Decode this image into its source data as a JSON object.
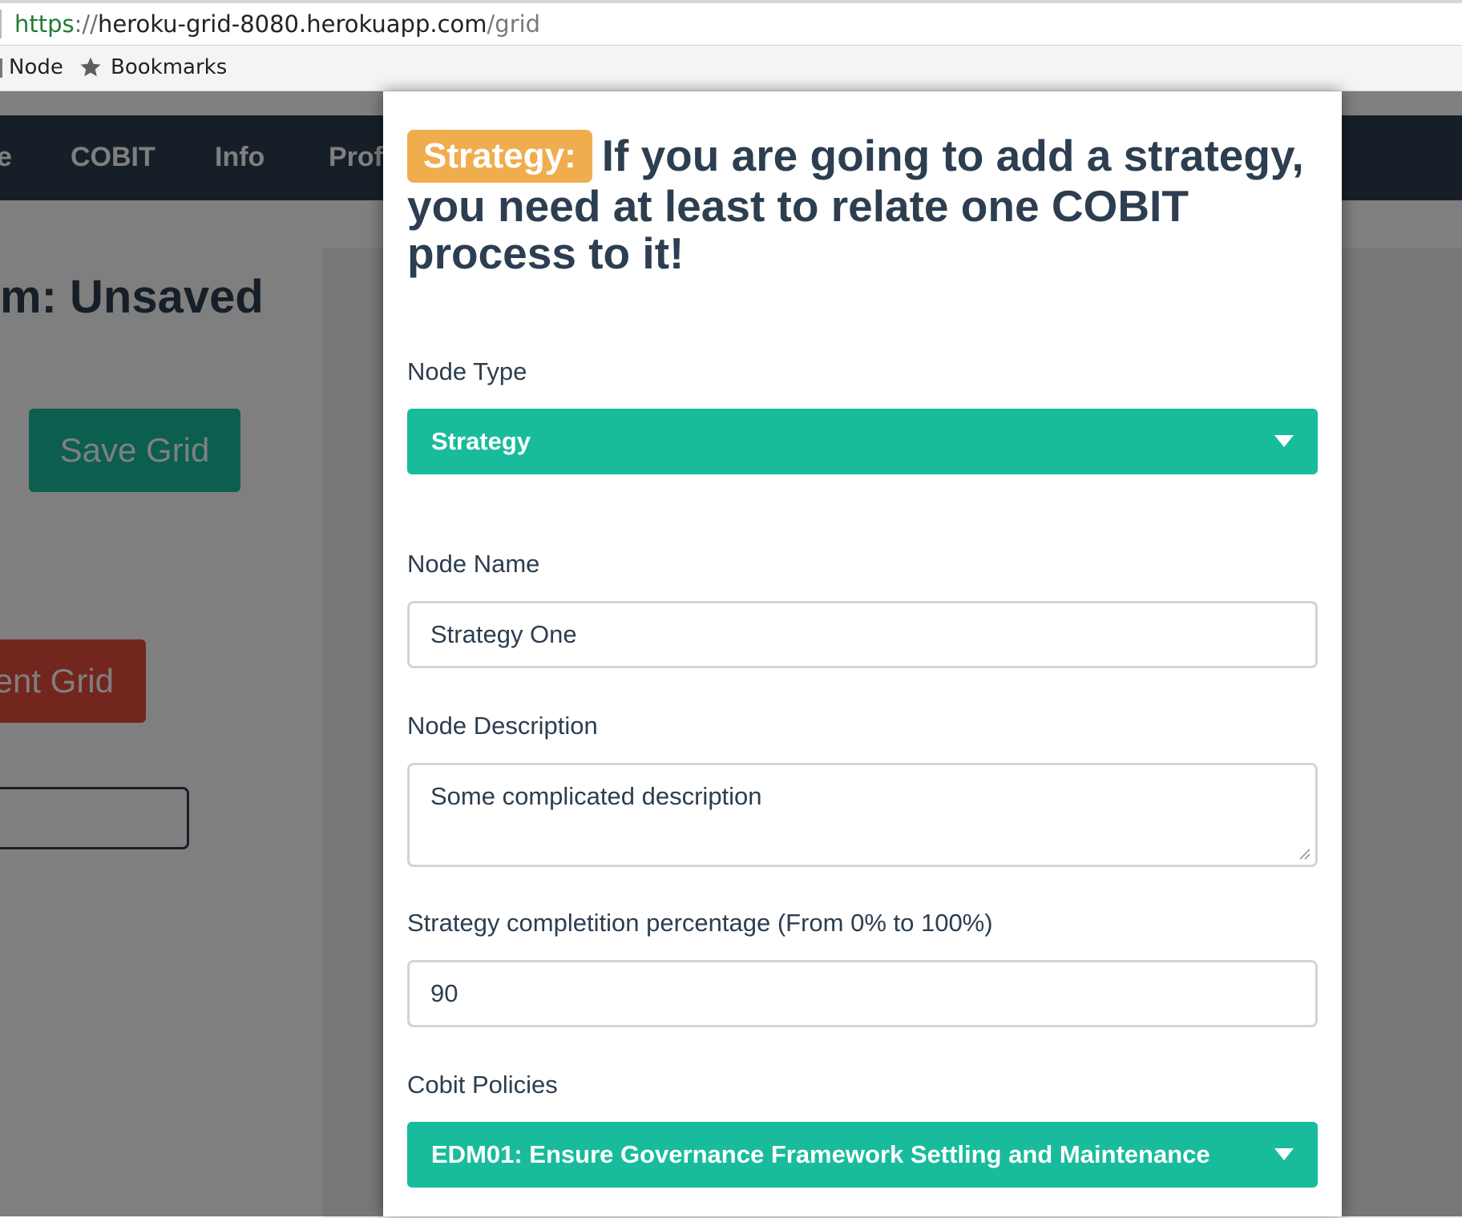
{
  "browser": {
    "url": {
      "scheme": "https",
      "separator": "://",
      "host": "heroku-grid-8080.herokuapp.com",
      "path": "/grid"
    },
    "bookmarks": [
      {
        "label": "Node"
      },
      {
        "label": "Bookmarks",
        "icon": "star-icon"
      }
    ]
  },
  "background_page": {
    "nav": {
      "partial_item": "e",
      "items": [
        "COBIT",
        "Info",
        "Profi"
      ]
    },
    "grid_title": "m:  Unsaved",
    "save_button": "Save Grid",
    "delete_button": "ent Grid"
  },
  "modal": {
    "cut_off_text": "· · · · · · · · · · · · ·",
    "badge": "Strategy:",
    "heading": "If you are going to add a strategy, you need at least to relate one COBIT process to it!",
    "node_type": {
      "label": "Node Type",
      "value": "Strategy"
    },
    "node_name": {
      "label": "Node Name",
      "value": "Strategy One"
    },
    "node_description": {
      "label": "Node Description",
      "value": "Some complicated description"
    },
    "completion": {
      "label": "Strategy completition percentage (From 0% to 100%)",
      "value": "90"
    },
    "cobit_policies": {
      "label": "Cobit Policies",
      "value": "EDM01: Ensure Governance Framework Settling and Maintenance"
    }
  },
  "colors": {
    "primary": "#2c3e50",
    "success": "#18bc9c",
    "danger": "#e74c3c",
    "warning": "#f0ad4e"
  }
}
